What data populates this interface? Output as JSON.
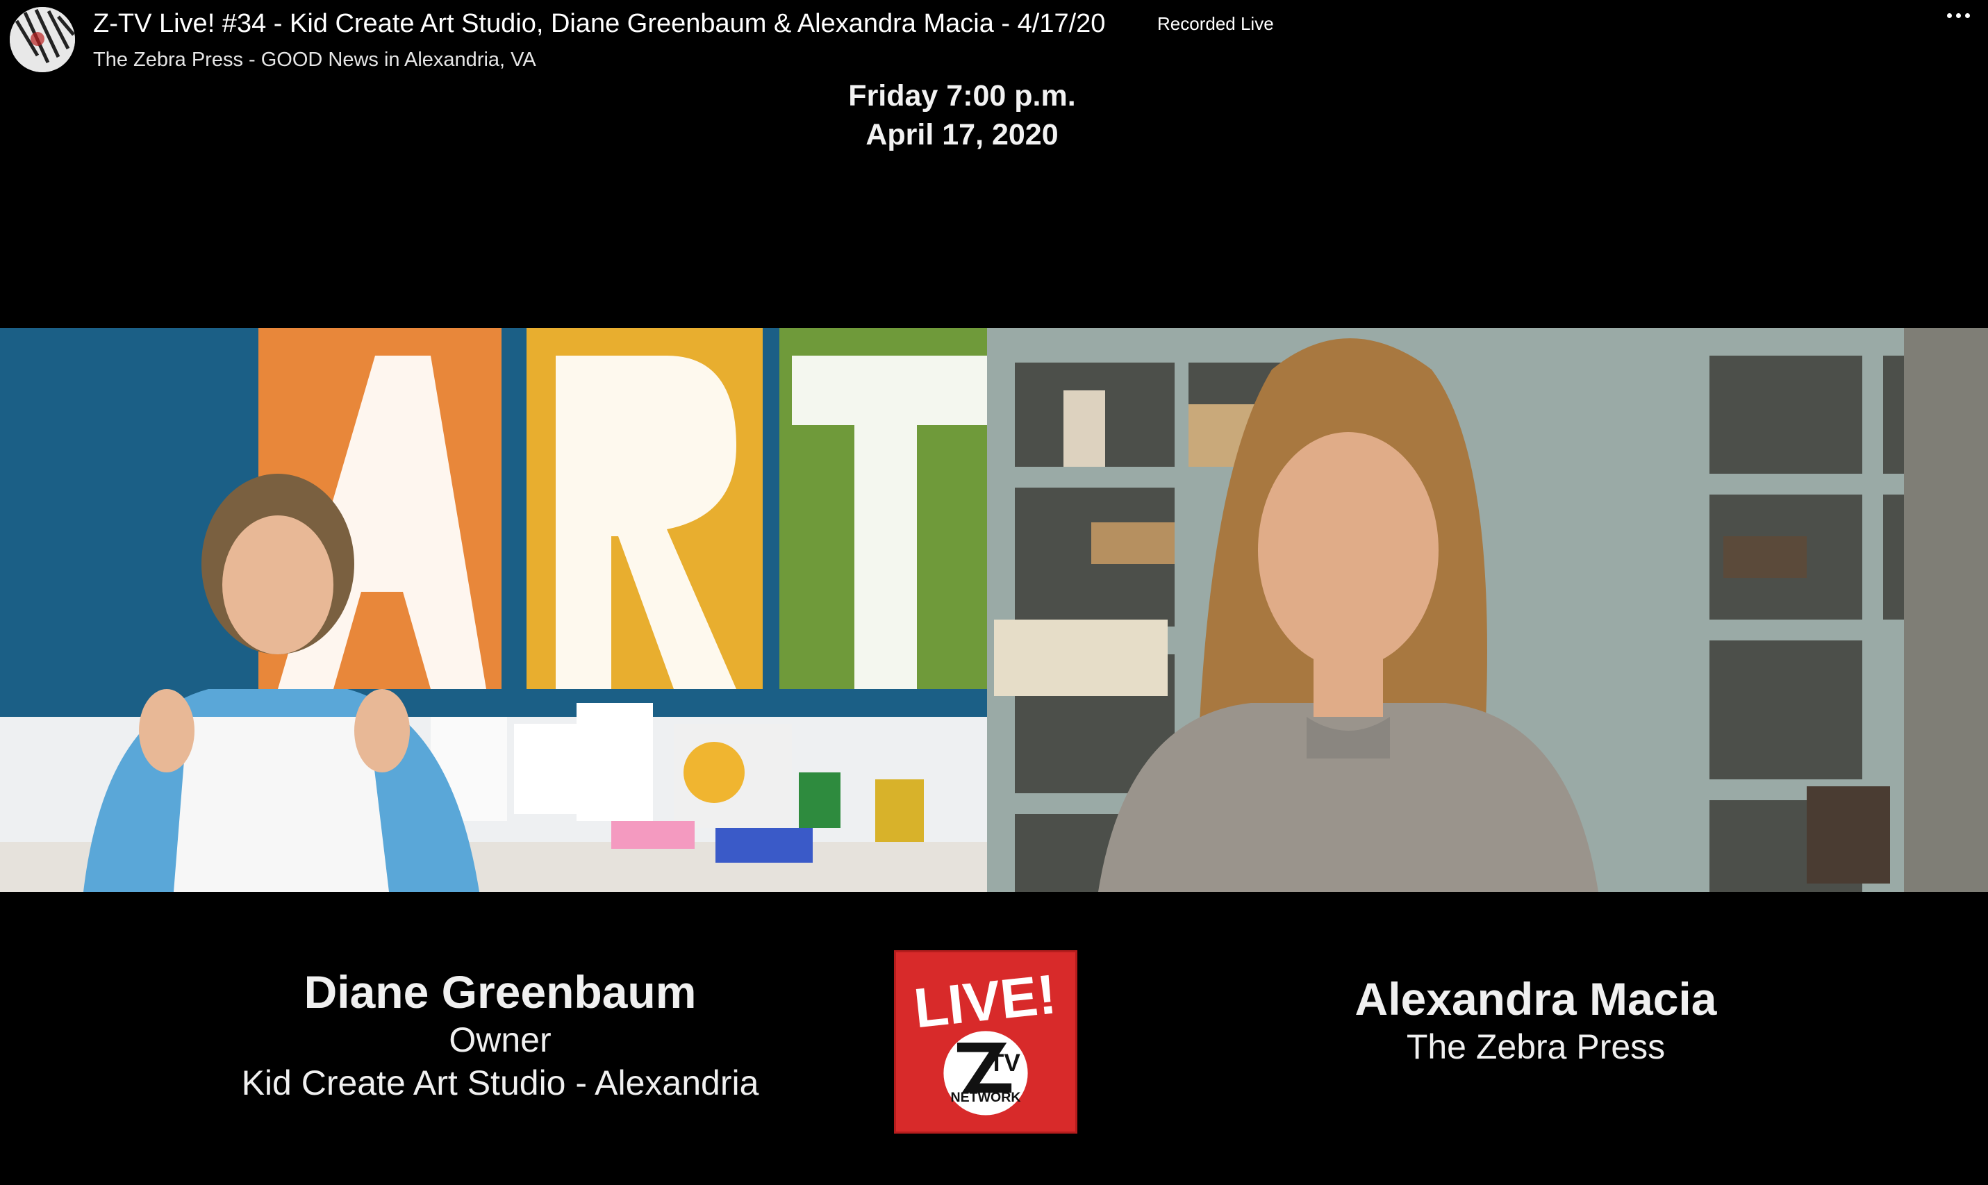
{
  "header": {
    "title": "Z-TV Live! #34 - Kid Create Art Studio, Diane Greenbaum & Alexandra Macia - 4/17/20",
    "badge": "Recorded Live",
    "page_name": "The Zebra Press - GOOD News in Alexandria, VA",
    "avatar_icon": "zebra-avatar-icon",
    "menu_icon": "more-options-icon"
  },
  "broadcast": {
    "day_time": "Friday 7:00 p.m.",
    "date": "April 17, 2020"
  },
  "left_guest": {
    "name": "Diane Greenbaum",
    "role": "Owner",
    "org": "Kid Create Art Studio - Alexandria"
  },
  "right_guest": {
    "name": "Alexandra Macia",
    "org": "The Zebra Press"
  },
  "logo": {
    "live_text": "LIVE!",
    "brand": "TV",
    "network": "NETWORK",
    "color": "#d82a2a"
  },
  "colors": {
    "background": "#000000",
    "left_wall": "#1b5f86",
    "right_wall": "#8a8a82"
  }
}
